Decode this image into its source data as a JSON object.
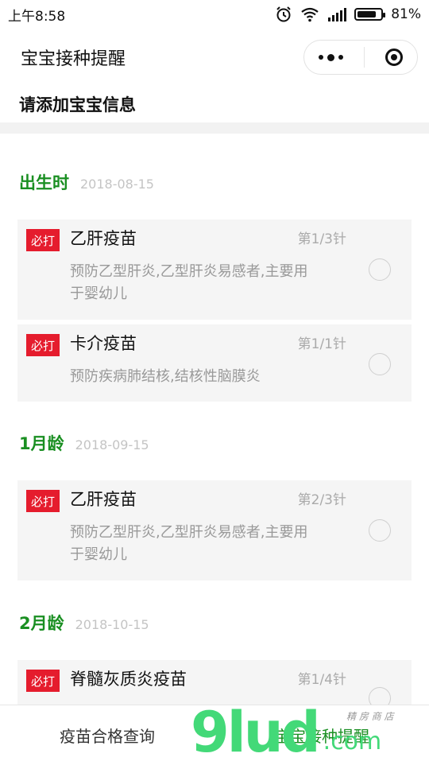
{
  "status_bar": {
    "time": "上午8:58",
    "battery_text": "81%",
    "battery_level": 0.81
  },
  "nav": {
    "title": "宝宝接种提醒"
  },
  "add_info": "请添加宝宝信息",
  "sections": [
    {
      "title": "出生时",
      "date": "2018-08-15",
      "cards": [
        {
          "badge": "必打",
          "name": "乙肝疫苗",
          "dose": "第1/3针",
          "desc_line1": "预防乙型肝炎,乙型肝炎易感者,主要用",
          "desc_line2": "于婴幼儿"
        },
        {
          "badge": "必打",
          "name": "卡介疫苗",
          "dose": "第1/1针",
          "desc_line1": "预防疾病肺结核,结核性脑膜炎",
          "desc_line2": ""
        }
      ]
    },
    {
      "title": "1月龄",
      "date": "2018-09-15",
      "cards": [
        {
          "badge": "必打",
          "name": "乙肝疫苗",
          "dose": "第2/3针",
          "desc_line1": "预防乙型肝炎,乙型肝炎易感者,主要用",
          "desc_line2": "于婴幼儿"
        }
      ]
    },
    {
      "title": "2月龄",
      "date": "2018-10-15",
      "cards": [
        {
          "badge": "必打",
          "name": "脊髓灰质炎疫苗",
          "dose": "第1/4针",
          "desc_line1": "",
          "desc_line2": ""
        }
      ]
    }
  ],
  "tabbar": {
    "tab1": "疫苗合格查询",
    "tab2": "宝宝接种提醒"
  },
  "watermark": {
    "big": "9lud",
    "com": ".com",
    "small": "精 房 商 店"
  },
  "colors": {
    "accent_green": "#1a8f22",
    "badge_red": "#e51c2d",
    "watermark_green": "#43d978"
  }
}
